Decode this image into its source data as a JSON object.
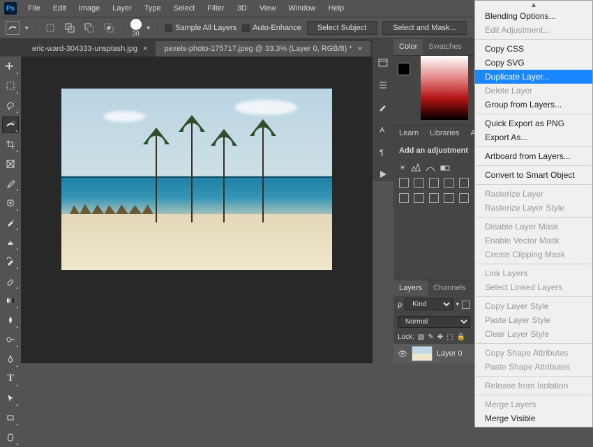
{
  "menu": {
    "items": [
      "File",
      "Edit",
      "Image",
      "Layer",
      "Type",
      "Select",
      "Filter",
      "3D",
      "View",
      "Window",
      "Help"
    ]
  },
  "options": {
    "brush_size": "30",
    "sample_all": "Sample All Layers",
    "auto_enhance": "Auto-Enhance",
    "select_subject": "Select Subject",
    "select_and_mask": "Select and Mask..."
  },
  "tabs": [
    {
      "label": "eric-ward-304333-unsplash.jpg",
      "active": false
    },
    {
      "label": "pexels-photo-175717.jpeg @ 33.3% (Layer 0, RGB/8) *",
      "active": true
    }
  ],
  "panels": {
    "color_tab": "Color",
    "swatches_tab": "Swatches",
    "learn_tab": "Learn",
    "libraries_tab": "Libraries",
    "adjust_label": "Add an adjustment",
    "layers_tab": "Layers",
    "channels_tab": "Channels",
    "kind_prefix": "ρ",
    "kind_value": "Kind",
    "blend_mode": "Normal",
    "lock_label": "Lock:",
    "layer0": "Layer 0"
  },
  "context_menu": {
    "blending": "Blending Options...",
    "edit_adj": "Edit Adjustment...",
    "copy_css": "Copy CSS",
    "copy_svg": "Copy SVG",
    "duplicate": "Duplicate Layer...",
    "delete": "Delete Layer",
    "group": "Group from Layers...",
    "quick_export": "Quick Export as PNG",
    "export_as": "Export As...",
    "artboard": "Artboard from Layers...",
    "smart_obj": "Convert to Smart Object",
    "rasterize": "Rasterize Layer",
    "rasterize_style": "Rasterize Layer Style",
    "dis_mask": "Disable Layer Mask",
    "en_vmask": "Enable Vector Mask",
    "clip_mask": "Create Clipping Mask",
    "link": "Link Layers",
    "sel_linked": "Select Linked Layers",
    "copy_style": "Copy Layer Style",
    "paste_style": "Paste Layer Style",
    "clear_style": "Clear Layer Style",
    "copy_shape": "Copy Shape Attributes",
    "paste_shape": "Paste Shape Attributes",
    "release": "Release from Isolation",
    "merge": "Merge Layers",
    "merge_vis": "Merge Visible"
  }
}
